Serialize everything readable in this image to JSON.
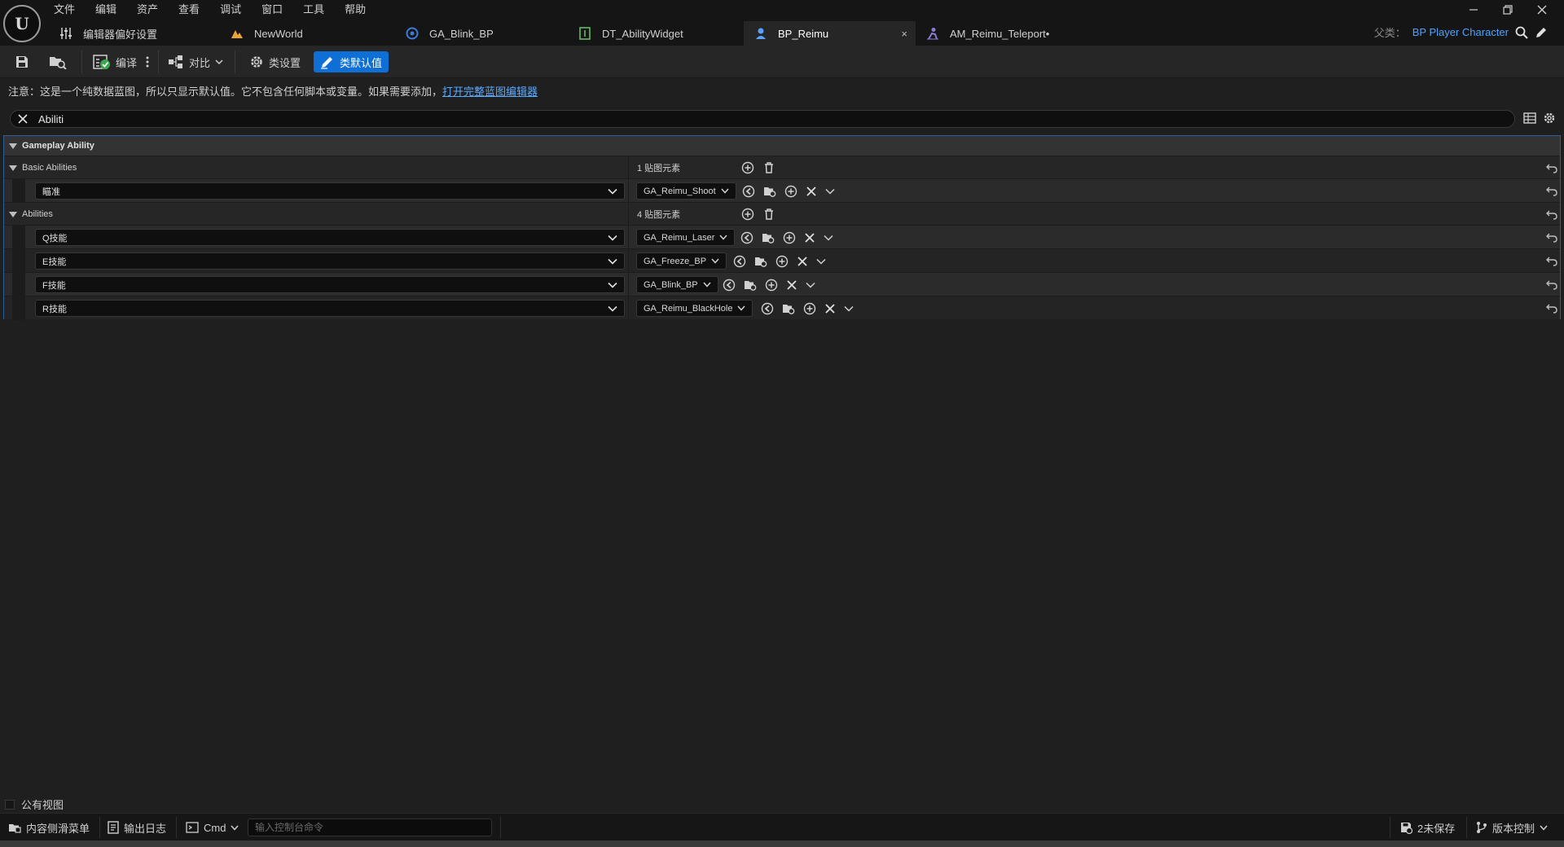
{
  "menu": [
    "文件",
    "编辑",
    "资产",
    "查看",
    "调试",
    "窗口",
    "工具",
    "帮助"
  ],
  "tabs": [
    {
      "label": "编辑器偏好设置",
      "icon": "sliders-icon",
      "color": "#cfcfcf"
    },
    {
      "label": "NewWorld",
      "icon": "level-icon",
      "color": "#e8a33a"
    },
    {
      "label": "GA_Blink_BP",
      "icon": "blueprint-icon",
      "color": "#3d7bd6"
    },
    {
      "label": "DT_AbilityWidget",
      "icon": "datatable-icon",
      "color": "#6cc26c"
    },
    {
      "label": "BP_Reimu",
      "icon": "character-icon",
      "color": "#5aa0ff",
      "close": "×"
    },
    {
      "label": "AM_Reimu_Teleport•",
      "icon": "montage-icon",
      "color": "#8a7bd6"
    }
  ],
  "parent": {
    "label": "父类：",
    "value": "BP Player Character"
  },
  "toolbar": {
    "compile": "编译",
    "diff": "对比",
    "class_settings": "类设置",
    "class_defaults": "类默认值"
  },
  "notice": {
    "text": "注意：这是一个纯数据蓝图，所以只显示默认值。它不包含任何脚本或变量。如果需要添加，",
    "link": "打开完整蓝图编辑器"
  },
  "search": {
    "value": "Abiliti"
  },
  "details": {
    "category": "Gameplay Ability",
    "basic": {
      "title": "Basic Abilities",
      "count": "1 贴图元素",
      "items": [
        {
          "key": "瞄准",
          "value": "GA_Reimu_Shoot"
        }
      ]
    },
    "abilities": {
      "title": "Abilities",
      "count": "4 贴图元素",
      "items": [
        {
          "key": "Q技能",
          "value": "GA_Reimu_Laser"
        },
        {
          "key": "E技能",
          "value": "GA_Freeze_BP"
        },
        {
          "key": "F技能",
          "value": "GA_Blink_BP"
        },
        {
          "key": "R技能",
          "value": "GA_Reimu_BlackHole"
        }
      ]
    }
  },
  "public_view": "公有视图",
  "status": {
    "content_drawer": "内容侧滑菜单",
    "output_log": "输出日志",
    "cmd": "Cmd",
    "console_placeholder": "输入控制台命令",
    "unsaved": "2未保存",
    "source_control": "版本控制"
  }
}
